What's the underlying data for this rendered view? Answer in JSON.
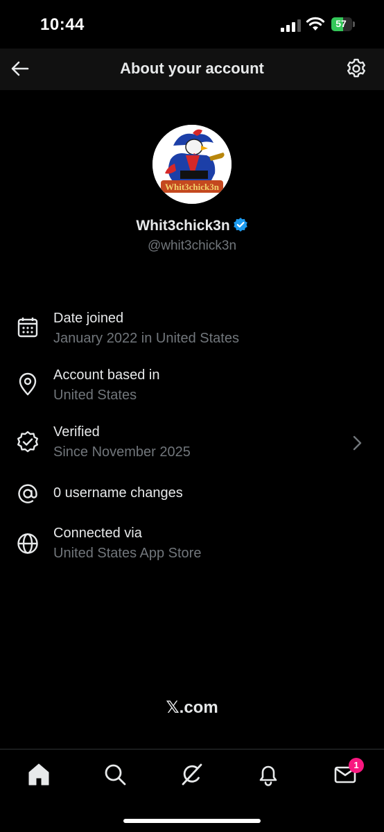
{
  "status_bar": {
    "time": "10:44",
    "battery_percent": "57",
    "battery_level": 0.57,
    "icons": [
      "cellular-signal-icon",
      "wifi-icon",
      "battery-charging-icon"
    ]
  },
  "header": {
    "title": "About your account",
    "back_icon": "arrow-left-icon",
    "settings_icon": "gear-icon"
  },
  "profile": {
    "display_name": "Whit3chick3n",
    "handle": "@whit3chick3n",
    "verified": true,
    "avatar_text": "Whit3chick3n"
  },
  "info_rows": [
    {
      "icon": "calendar-icon",
      "title": "Date joined",
      "subtitle": "January 2022 in United States"
    },
    {
      "icon": "location-pin-icon",
      "title": "Account based in",
      "subtitle": "United States"
    },
    {
      "icon": "verified-check-icon",
      "title": "Verified",
      "subtitle": "Since November 2025"
    },
    {
      "icon": "at-sign-icon",
      "title": "0 username changes",
      "subtitle": ""
    },
    {
      "icon": "globe-icon",
      "title": "Connected via",
      "subtitle": "United States App Store"
    }
  ],
  "footer": {
    "logo_text": "𝕏.com"
  },
  "tab_bar": {
    "tabs": [
      "home-icon",
      "search-icon",
      "grok-icon",
      "notifications-bell-icon",
      "messages-icon"
    ],
    "messages_badge": "1"
  },
  "colors": {
    "background": "#000000",
    "header_bg": "#111111",
    "primary_text": "#e7e9ea",
    "secondary_text": "#71767b",
    "verified_blue": "#1d9bf0",
    "badge_pink": "#f91880",
    "battery_green": "#34c759"
  }
}
